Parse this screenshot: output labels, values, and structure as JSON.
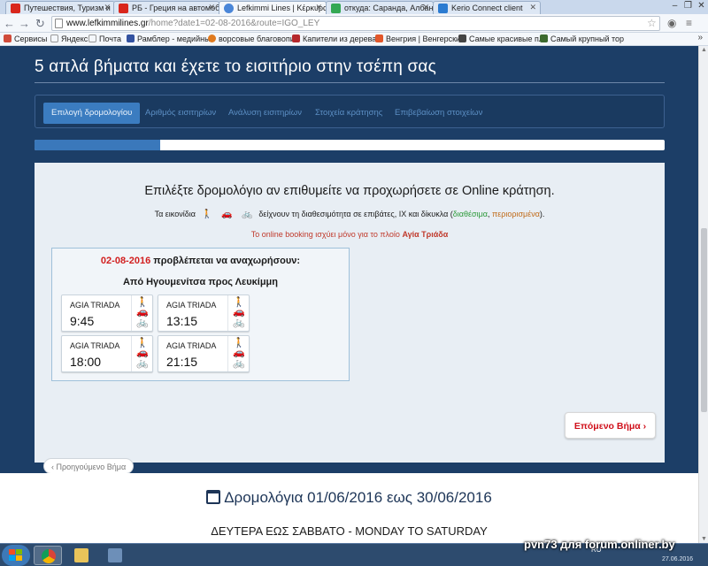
{
  "browser": {
    "tabs": [
      {
        "title": "Путешествия, Туризм и",
        "icon_color": "#d9261c"
      },
      {
        "title": "РБ - Греция на автомоб",
        "icon_color": "#d9261c"
      },
      {
        "title": "Lefkimmi Lines | Κέρκυρα",
        "icon_color": "#4a86d8"
      },
      {
        "title": "откуда: Саранда, Албани",
        "icon_color": "#34a853"
      },
      {
        "title": "Kerio Connect client",
        "icon_color": "#2b7bd1"
      }
    ],
    "url_domain": "www.lefkimmilines.gr",
    "url_path": "/home?date1=02-08-2016&route=IGO_LEY",
    "bookmarks": [
      {
        "label": "Сервисы",
        "icon_color": "#d04b3a"
      },
      {
        "label": "Яндекс",
        "icon_color": "#ffffff"
      },
      {
        "label": "Почта",
        "icon_color": "#ffffff"
      },
      {
        "label": "Рамблер - медийны",
        "icon_color": "#3352a0"
      },
      {
        "label": "ворсовые благовопи",
        "icon_color": "#e07a1e"
      },
      {
        "label": "Капители из дерева.",
        "icon_color": "#b5282c"
      },
      {
        "label": "Венгрия | Венгерский",
        "icon_color": "#e2572a"
      },
      {
        "label": "Самые красивые пла",
        "icon_color": "#444444"
      },
      {
        "label": "Самый крупный тор",
        "icon_color": "#3d6a2e"
      }
    ]
  },
  "hero": {
    "title": "5 απλά βήματα και έχετε το εισιτήριο στην τσέπη σας"
  },
  "wizard": {
    "steps": [
      {
        "label": "Επιλογή δρομολογίου"
      },
      {
        "label": "Αριθμός εισιτηρίων"
      },
      {
        "label": "Ανάλυση εισιτηρίων"
      },
      {
        "label": "Στοιχεία κράτησης"
      },
      {
        "label": "Επιβεβαίωση στοιχείων"
      }
    ],
    "active_step": 1,
    "progress": 0.2
  },
  "panel": {
    "heading": "Επιλέξτε δρομολόγιο αν επιθυμείτε να προχωρήσετε σε Online κράτηση.",
    "legend_prefix": "Τα εικονίδια",
    "legend_middle": "δείχνουν τη διαθεσιμότητα σε επιβάτες, ΙΧ και δίκυκλα (",
    "legend_available": "διαθέσιμα",
    "legend_sep": ", ",
    "legend_limited": "περιορισμένα",
    "legend_suffix": ").",
    "notice_prefix": "Το online booking ισχύει μόνο για το πλοίο",
    "notice_ship": "Αγία Τριάδα"
  },
  "schedule": {
    "date": "02-08-2016",
    "date_suffix": "προβλέπεται να αναχωρήσουν:",
    "route": "Από Ηγουμενίτσα προς Λευκίμμη",
    "trips": [
      {
        "ship": "AGIA TRIADA",
        "time": "9:45"
      },
      {
        "ship": "AGIA TRIADA",
        "time": "13:15"
      },
      {
        "ship": "AGIA TRIADA",
        "time": "18:00"
      },
      {
        "ship": "AGIA TRIADA",
        "time": "21:15"
      }
    ]
  },
  "nav": {
    "prev_label": "Προηγούμενο Βήμα",
    "next_label": "Επόμενο Βήμα"
  },
  "below": {
    "schedule_title": "Δρομολόγια 01/06/2016 εως 30/06/2016",
    "subtitle": "ΔΕΥΤΕΡΑ ΕΩΣ ΣΑΒΒΑΤΟ - MONDAY TO SATURDAY"
  },
  "taskbar": {
    "watermark": "pvn73 для forum.onliner.by",
    "lang": "RU",
    "date": "27.06.2016"
  },
  "colors": {
    "hero_bg": "#1c3e67",
    "accent_blue": "#3b7cc0",
    "date_red": "#d21f1f",
    "next_red": "#d0101b",
    "available_green": "#2d9a3a"
  }
}
